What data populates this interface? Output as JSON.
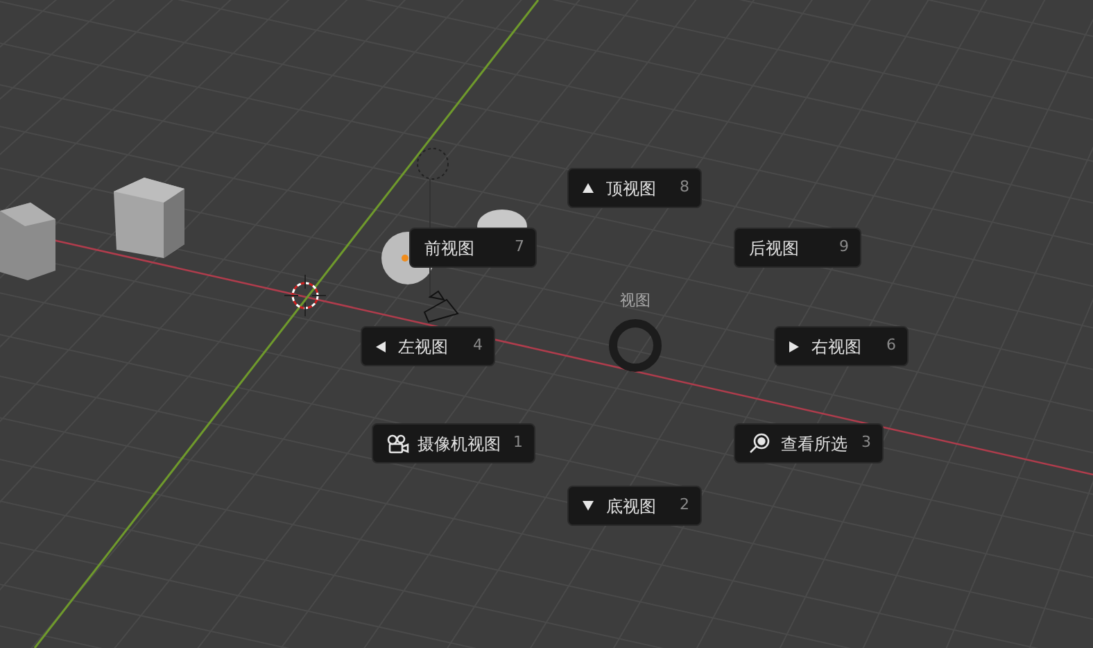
{
  "pie_menu": {
    "title": "视图",
    "items": [
      {
        "kind": "arrow-up",
        "label": "顶视图",
        "shortcut": "8"
      },
      {
        "kind": "plain",
        "label": "前视图",
        "shortcut": "7"
      },
      {
        "kind": "plain",
        "label": "后视图",
        "shortcut": "9"
      },
      {
        "kind": "arrow-left",
        "label": "左视图",
        "shortcut": "4"
      },
      {
        "kind": "arrow-right",
        "label": "右视图",
        "shortcut": "6"
      },
      {
        "kind": "camera",
        "label": "摄像机视图",
        "shortcut": "1"
      },
      {
        "kind": "zoom",
        "label": "查看所选",
        "shortcut": "3"
      },
      {
        "kind": "arrow-down",
        "label": "底视图",
        "shortcut": "2"
      }
    ]
  }
}
